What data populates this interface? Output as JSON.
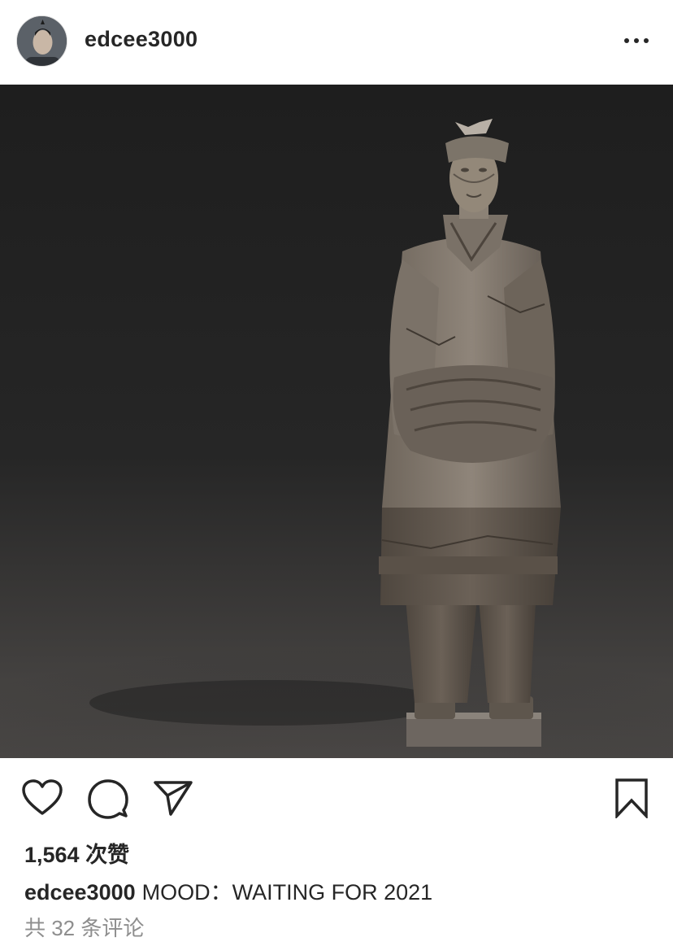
{
  "post": {
    "username": "edcee3000",
    "more_icon": "more-horizontal-icon",
    "avatar_icon": "user-avatar",
    "image_description_icon": "terracotta-warrior-photo",
    "actions": {
      "like_icon": "heart-icon",
      "comment_icon": "comment-icon",
      "share_icon": "send-icon",
      "save_icon": "bookmark-icon"
    },
    "likes_text": "1,564 次赞",
    "caption": {
      "username": "edcee3000",
      "text": "MOOD：WAITING FOR 2021"
    },
    "comments_text": "共 32 条评论"
  },
  "colors": {
    "text": "#262626",
    "muted": "#8e8e8e",
    "background": "#ffffff",
    "photo_background": "#1f1f1f"
  }
}
